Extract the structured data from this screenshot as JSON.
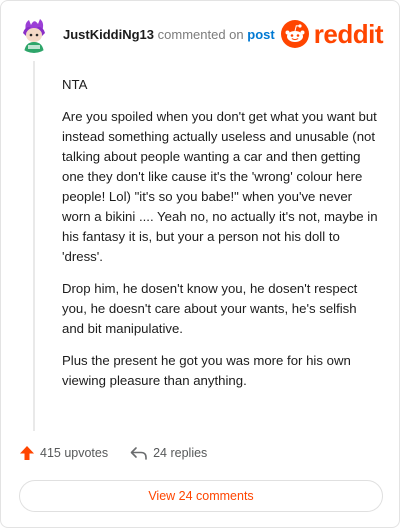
{
  "header": {
    "username": "JustKiddiNg13",
    "commented": "commented on",
    "post_link": "post",
    "logo_text": "reddit"
  },
  "comment": {
    "paragraphs": [
      "NTA",
      "Are you spoiled when you don't get what you want but instead something actually useless and unusable (not talking about people wanting a car and then getting one they don't like cause it's the 'wrong' colour here people! Lol) \"it's so you babe!\" when you've never worn a bikini .... Yeah no, no actually it's not, maybe in his fantasy it is, but your a person not his doll to 'dress'.",
      "Drop him, he dosen't know you, he dosen't respect you, he doesn't care about your wants, he's selfish and bit manipulative.",
      "Plus the present he got you was more for his own viewing pleasure than anything."
    ]
  },
  "actions": {
    "upvotes": "415 upvotes",
    "replies": "24 replies"
  },
  "view_button": "View 24 comments",
  "colors": {
    "brand": "#ff4500",
    "link": "#0079d3"
  },
  "icons": {
    "avatar": "snoo-avatar",
    "logo": "reddit-snoo-icon",
    "upvote": "upvote-arrow-icon",
    "reply": "reply-arrow-icon"
  }
}
